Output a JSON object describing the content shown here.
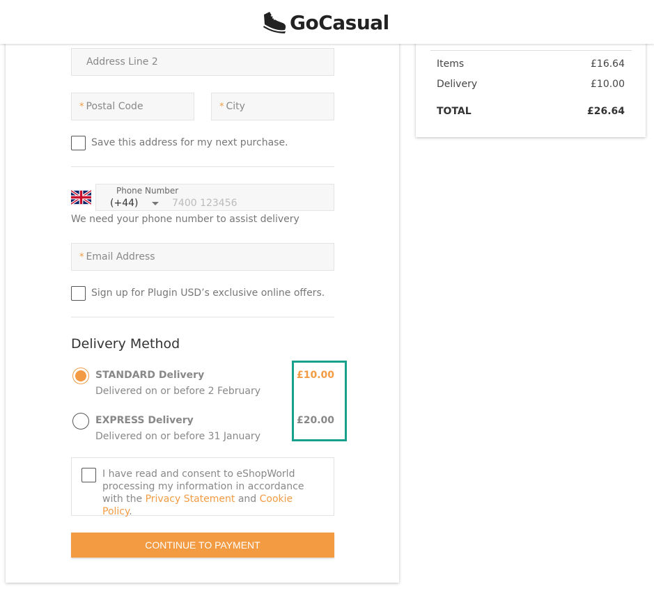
{
  "header": {
    "brand": "GoCasual",
    "logo_icon": "sneaker-icon"
  },
  "address": {
    "line2_placeholder": "Address Line 2",
    "postal_placeholder": "Postal Code",
    "city_placeholder": "City",
    "required_mark": "*",
    "save_label": "Save this address for my next purchase."
  },
  "phone": {
    "label": "Phone Number",
    "country_code": "(+44)",
    "placeholder": "7400 123456",
    "helper": "We need your phone number to assist delivery",
    "flag_icon": "uk-flag-icon"
  },
  "email": {
    "placeholder": "Email Address",
    "signup_label": "Sign up for Plugin USD’s exclusive online offers."
  },
  "delivery": {
    "title": "Delivery Method",
    "options": [
      {
        "name": "STANDARD Delivery",
        "desc": "Delivered on or before 2 February",
        "price": "£10.00",
        "selected": true
      },
      {
        "name": "EXPRESS Delivery",
        "desc": "Delivered on or before 31 January",
        "price": "£20.00",
        "selected": false
      }
    ]
  },
  "consent": {
    "text_before": "I have read and consent to eShopWorld processing my information in accordance with the ",
    "privacy_link": "Privacy Statement",
    "and": " and ",
    "cookie_link": "Cookie Policy",
    "period": "."
  },
  "cta": {
    "label": "CONTINUE TO PAYMENT"
  },
  "summary": {
    "items_label": "Items",
    "items_value": "£16.64",
    "delivery_label": "Delivery",
    "delivery_value": "£10.00",
    "total_label": "TOTAL",
    "total_value": "£26.64"
  },
  "colors": {
    "accent": "#f29b43",
    "highlight": "#17a08c"
  }
}
